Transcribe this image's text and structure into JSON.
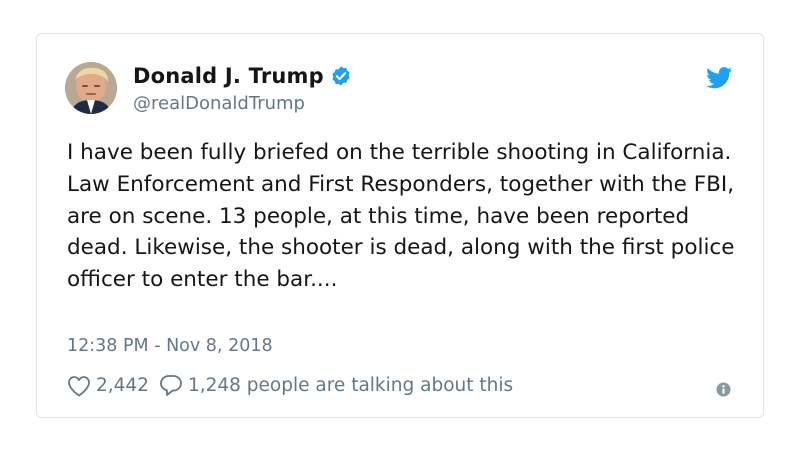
{
  "tweet": {
    "author_name": "Donald J. Trump",
    "author_handle": "@realDonaldTrump",
    "verified": true,
    "text": "I have been fully briefed on the terrible shooting in California. Law Enforcement and First Responders, together with the FBI, are on scene. 13 people, at this time, have been reported dead. Likewise, the shooter is dead, along with the first police officer to enter the bar....",
    "timestamp": "12:38 PM - Nov 8, 2018",
    "likes": "2,442",
    "replies_text": "1,248 people are talking about this"
  },
  "icons": {
    "avatar": "profile-photo",
    "verified": "verified-badge-icon",
    "bird": "twitter-bird-icon",
    "like": "heart-icon",
    "reply": "speech-bubble-icon",
    "info": "info-icon"
  },
  "colors": {
    "brand": "#1da1f2",
    "text": "#14171a",
    "secondary_text": "#657786",
    "border": "#dfe3e6"
  }
}
